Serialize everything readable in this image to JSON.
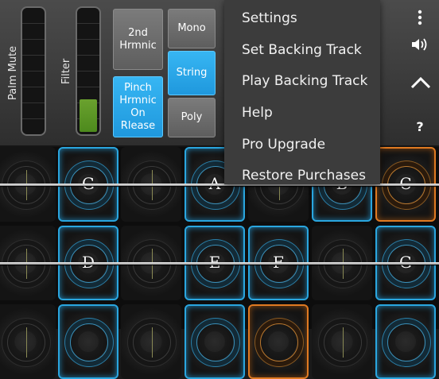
{
  "panel": {
    "palm_mute_label": "Palm Mute",
    "filter_label": "Filter",
    "palm_mute_level": 0,
    "filter_level": 0.27,
    "buttons": {
      "second_harmonic": "2nd\nHrmnic",
      "pinch_harmonic": "Pinch\nHrmnic\nOn\nRlease",
      "mono": "Mono",
      "string": "String",
      "poly": "Poly"
    },
    "side_icons": [
      "more-vertical-icon",
      "speaker-icon",
      "chevron-up-icon",
      "help-icon"
    ],
    "help_glyph": "?"
  },
  "menu": {
    "items": [
      "Settings",
      "Set Backing Track",
      "Play Backing Track",
      "Help",
      "Pro Upgrade",
      "Restore Purchases"
    ]
  },
  "board": {
    "row1_notes": [
      "G",
      "A",
      "B",
      "C"
    ],
    "row2_notes": [
      "D",
      "E",
      "F",
      "G"
    ]
  },
  "colors": {
    "accent_blue": "#2aa6df",
    "accent_orange": "#e07a22",
    "selected_button": "#1f98dd",
    "filter_fill": "#4d8a1d"
  }
}
